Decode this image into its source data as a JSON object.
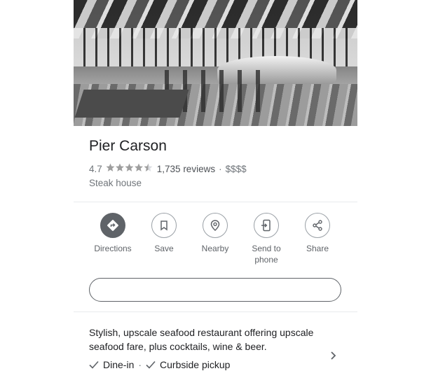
{
  "place": {
    "name": "Pier Carson",
    "rating": "4.7",
    "stars_filled": 4.5,
    "stars_display": "★★★★★",
    "reviews": "1,735 reviews",
    "separator": "·",
    "price": "$$$$",
    "category": "Steak house"
  },
  "actions": [
    {
      "label": "Directions",
      "icon": "directions-icon"
    },
    {
      "label": "Save",
      "icon": "bookmark-icon"
    },
    {
      "label": "Nearby",
      "icon": "nearby-pin-icon"
    },
    {
      "label": "Send to\nphone",
      "icon": "send-to-phone-icon"
    },
    {
      "label": "Share",
      "icon": "share-icon"
    }
  ],
  "description": "Stylish, upscale seafood restaurant offering upscale seafood fare, plus cocktails, wine & beer.",
  "service_options": [
    {
      "label": "Dine-in",
      "icon": "check-icon"
    },
    {
      "label": "Curbside pickup",
      "icon": "check-icon"
    }
  ],
  "service_separator": "·",
  "colors": {
    "primary_text": "#202124",
    "secondary_text": "#70757a",
    "icon_gray": "#5f6368",
    "divider": "#e8eaed"
  }
}
